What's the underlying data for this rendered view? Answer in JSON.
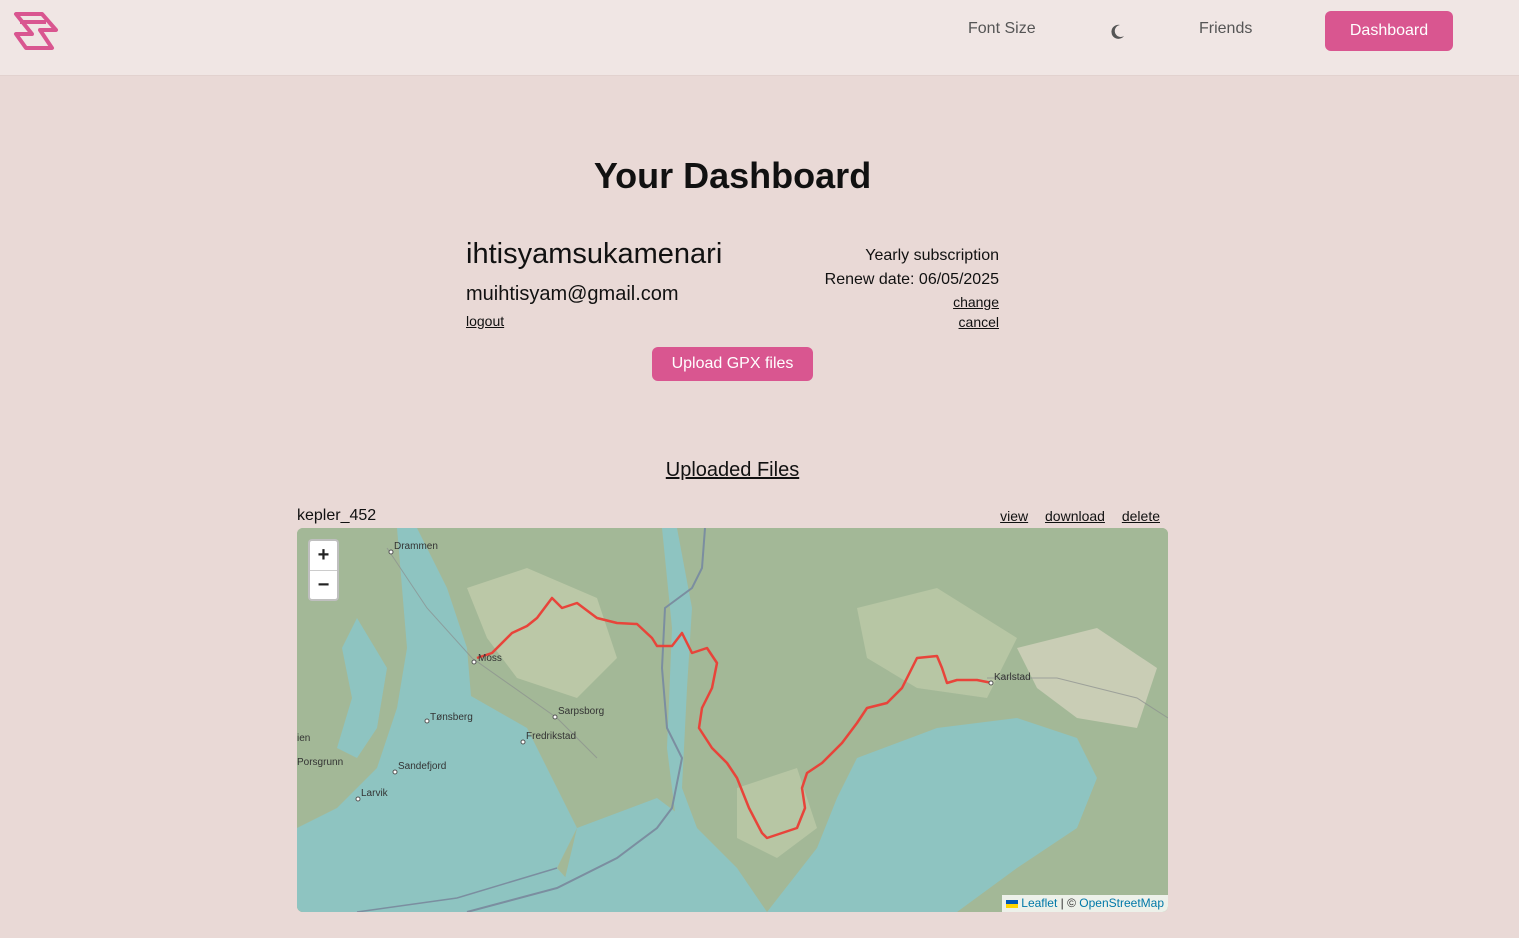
{
  "header": {
    "logo_icon": "brand-logo",
    "nav": {
      "font_size": "Font Size",
      "theme_icon": "moon-icon",
      "friends": "Friends",
      "dashboard": "Dashboard"
    },
    "accent_color": "#d95690"
  },
  "page": {
    "title": "Your Dashboard"
  },
  "profile": {
    "username": "ihtisyamsukamenari",
    "email": "muihtisyam@gmail.com",
    "logout": "logout"
  },
  "subscription": {
    "plan": "Yearly subscription",
    "renew": "Renew date: 06/05/2025",
    "change": "change",
    "cancel": "cancel"
  },
  "upload_button": "Upload GPX files",
  "files": {
    "heading": "Uploaded Files",
    "items": [
      {
        "name": "kepler_452",
        "actions": {
          "view": "view",
          "download": "download",
          "delete": "delete"
        }
      }
    ]
  },
  "map": {
    "zoom_in": "+",
    "zoom_out": "−",
    "attribution": {
      "leaflet": "Leaflet",
      "separator": "| ©",
      "osm": "OpenStreetMap"
    },
    "places": [
      "Drammen",
      "Moss",
      "Tønsberg",
      "Sarpsborg",
      "Fredrikstad",
      "ien",
      "Porsgrunn",
      "Sandefjord",
      "Larvik",
      "Karlstad"
    ],
    "route_color": "#e8443a"
  }
}
